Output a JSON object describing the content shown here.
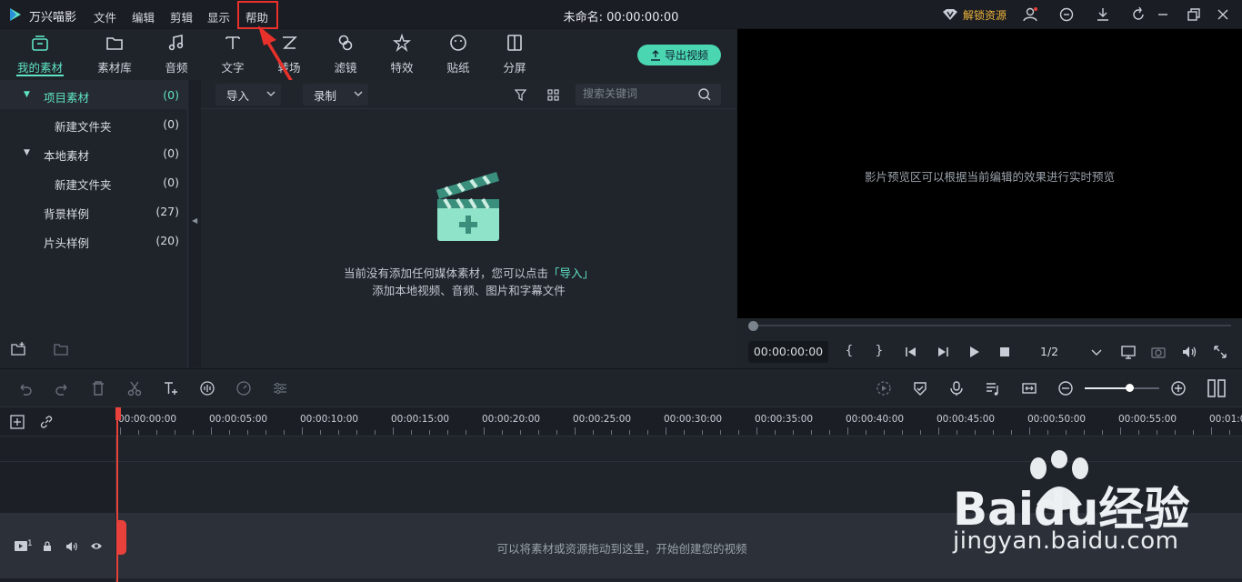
{
  "app": {
    "name": "万兴喵影",
    "doc_title": "未命名: 00:00:00:00",
    "unlock_label": "解锁资源"
  },
  "menu": [
    "文件",
    "编辑",
    "剪辑",
    "显示",
    "帮助"
  ],
  "tools": [
    "我的素材",
    "素材库",
    "音频",
    "文字",
    "转场",
    "滤镜",
    "特效",
    "贴纸",
    "分屏"
  ],
  "export_label": "导出视频",
  "tree": [
    {
      "label": "项目素材",
      "count": "(0)"
    },
    {
      "label": "新建文件夹",
      "count": "(0)"
    },
    {
      "label": "本地素材",
      "count": "(0)"
    },
    {
      "label": "新建文件夹",
      "count": "(0)"
    },
    {
      "label": "背景样例",
      "count": "(27)"
    },
    {
      "label": "片头样例",
      "count": "(20)"
    }
  ],
  "media": {
    "import_label": "导入",
    "record_label": "录制",
    "search_placeholder": "搜索关键词",
    "empty_line1_a": "当前没有添加任何媒体素材，您可以点击",
    "empty_line1_link": "「导入」",
    "empty_line2": "添加本地视频、音频、图片和字幕文件"
  },
  "preview": {
    "hint": "影片预览区可以根据当前编辑的效果进行实时预览",
    "timecode": "00:00:00:00",
    "ratio": "1/2"
  },
  "ruler": [
    "00:00:00:00",
    "00:00:05:00",
    "00:00:10:00",
    "00:00:15:00",
    "00:00:20:00",
    "00:00:25:00",
    "00:00:30:00",
    "00:00:35:00",
    "00:00:40:00",
    "00:00:45:00",
    "00:00:50:00",
    "00:00:55:00",
    "00:01:0"
  ],
  "timeline": {
    "track_num": "1",
    "drop_hint": "可以将素材或资源拖动到这里，开始创建您的视频"
  },
  "watermark": {
    "brand": "Baidu经验",
    "url": "jingyan.baidu.com"
  },
  "colors": {
    "accent": "#5fe3c4",
    "annotation": "#e8312b",
    "playhead": "#e8413c"
  }
}
